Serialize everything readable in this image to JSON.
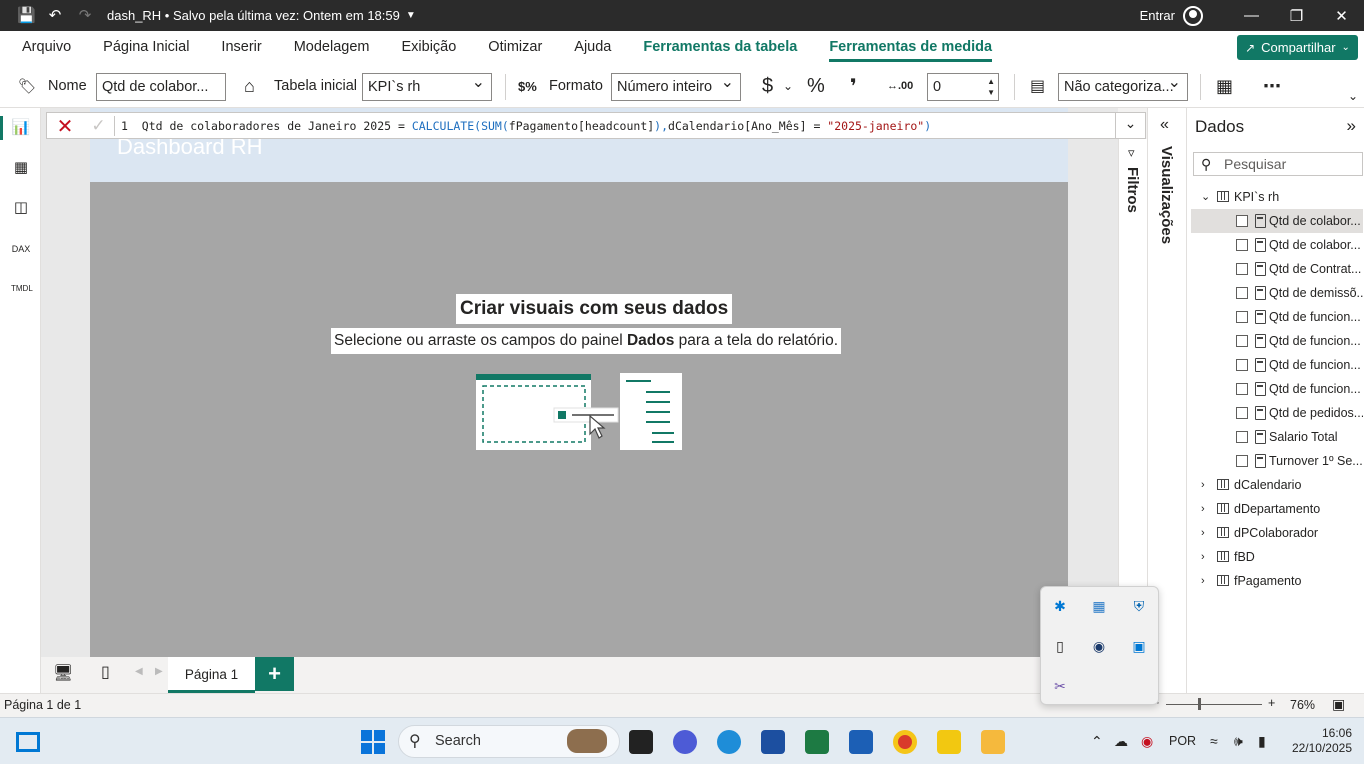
{
  "titlebar": {
    "title": "dash_RH • Salvo pela última vez: Ontem em 18:59",
    "sign_in": "Entrar"
  },
  "menu": {
    "items": [
      "Arquivo",
      "Página Inicial",
      "Inserir",
      "Modelagem",
      "Exibição",
      "Otimizar",
      "Ajuda"
    ],
    "context_items": [
      "Ferramentas da tabela",
      "Ferramentas de medida"
    ],
    "share": "Compartilhar"
  },
  "ribbon": {
    "name_label": "Nome",
    "name_value": "Qtd de colabor...",
    "home_table_label": "Tabela inicial",
    "home_table_value": "KPI`s rh",
    "format_label": "Formato",
    "format_value": "Número inteiro",
    "currency": "$",
    "percent": "%",
    "comma": "❜",
    "decimals_value": "0",
    "category_value": "Não categoriza..."
  },
  "formula": {
    "line": "1",
    "text_plain": "Qtd de colaboradores de Janeiro 2025 = ",
    "fn1": "CALCULATE(SUM(",
    "arg1": "fPagamento[headcount]",
    "fn1_close": "),",
    "arg2": "dCalendario[Ano_Mês]",
    "eq": " = ",
    "str": "\"2025-janeiro\"",
    "close": ")"
  },
  "report": {
    "title": "Dashboard RH",
    "empty_title": "Criar visuais com seus dados",
    "empty_sub_before": "Selecione ou arraste os campos do painel ",
    "empty_sub_bold": "Dados",
    "empty_sub_after": " para a tela do relatório."
  },
  "pages": {
    "current": "Página 1",
    "status": "Página 1 de 1"
  },
  "panes": {
    "filters": "Filtros",
    "visualizations": "Visualizações",
    "data_title": "Dados",
    "search_placeholder": "Pesquisar"
  },
  "data_tree": {
    "kpi_table": "KPI`s rh",
    "measures": [
      "Qtd de colabor...",
      "Qtd de colabor...",
      "Qtd de Contrat...",
      "Qtd de demissõ...",
      "Qtd de funcion...",
      "Qtd de funcion...",
      "Qtd de funcion...",
      "Qtd de funcion...",
      "Qtd de pedidos...",
      "Salario Total",
      "Turnover 1º Se..."
    ],
    "tables": [
      "dCalendario",
      "dDepartamento",
      "dPColaborador",
      "fBD",
      "fPagamento"
    ]
  },
  "status": {
    "zoom": "76%"
  },
  "taskbar": {
    "search": "Search",
    "lang": "POR",
    "time": "16:06",
    "date": "22/10/2025"
  },
  "colors": {
    "accent": "#117865",
    "titlebar": "#2b2b2b",
    "canvas": "#a6a6a6",
    "header": "#dbe6f2"
  }
}
